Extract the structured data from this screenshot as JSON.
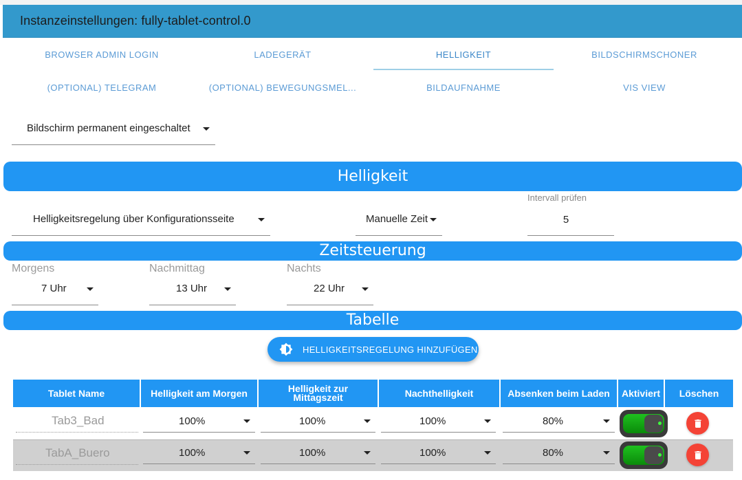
{
  "window": {
    "title": "Instanzeinstellungen: fully-tablet-control.0"
  },
  "tabs": [
    {
      "label": "BROWSER ADMIN LOGIN"
    },
    {
      "label": "LADEGERÄT"
    },
    {
      "label": "HELLIGKEIT",
      "active": true
    },
    {
      "label": "BILDSCHIRMSCHONER"
    },
    {
      "label": "(OPTIONAL) TELEGRAM"
    },
    {
      "label": "(OPTIONAL) BEWEGUNGSMEL..."
    },
    {
      "label": "BILDAUFNAHME"
    },
    {
      "label": "VIS VIEW"
    }
  ],
  "screen_select": {
    "value": "Bildschirm permanent eingeschaltet"
  },
  "sections": {
    "helligkeit": "Helligkeit",
    "zeitsteuerung": "Zeitsteuerung",
    "tabelle": "Tabelle"
  },
  "helligkeit": {
    "mode_select": "Helligkeitsregelung über Konfigurationsseite",
    "time_select": "Manuelle Zeit",
    "interval_label": "Intervall prüfen",
    "interval_value": "5"
  },
  "zeitsteuerung": {
    "morgens": {
      "label": "Morgens",
      "value": "7 Uhr"
    },
    "nachmittag": {
      "label": "Nachmittag",
      "value": "13 Uhr"
    },
    "nachts": {
      "label": "Nachts",
      "value": "22 Uhr"
    }
  },
  "add_button": {
    "label": "HELLIGKEITSREGELUNG HINZUFÜGEN",
    "icon": "brightness-icon"
  },
  "table": {
    "headers": [
      "Tablet Name",
      "Helligkeit am Morgen",
      "Helligkeit zur Mittagszeit",
      "Nachthelligkeit",
      "Absenken beim Laden",
      "Aktiviert",
      "Löschen"
    ],
    "rows": [
      {
        "name": "Tab3_Bad",
        "morgen": "100%",
        "mittag": "100%",
        "nacht": "100%",
        "laden": "80%",
        "aktiviert": true
      },
      {
        "name": "TabA_Buero",
        "morgen": "100%",
        "mittag": "100%",
        "nacht": "100%",
        "laden": "80%",
        "aktiviert": true
      }
    ]
  },
  "colors": {
    "titlebar": "#3399cc",
    "accent": "#2196f3",
    "tab_text": "#5b9bd5",
    "delete": "#f44336",
    "toggle_on": "#1fc11f",
    "row_alt": "#d0d0d0"
  }
}
